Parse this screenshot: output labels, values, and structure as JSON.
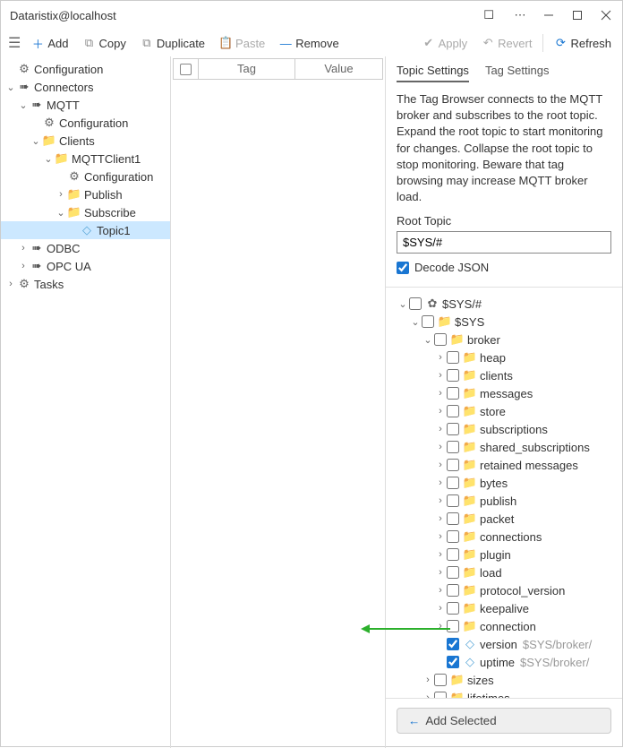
{
  "window": {
    "title": "Dataristix@localhost"
  },
  "toolbar": {
    "add": "Add",
    "copy": "Copy",
    "duplicate": "Duplicate",
    "paste": "Paste",
    "remove": "Remove",
    "apply": "Apply",
    "revert": "Revert",
    "refresh": "Refresh"
  },
  "left_tree": {
    "n0": "Configuration",
    "n1": "Connectors",
    "n2": "MQTT",
    "n3": "Configuration",
    "n4": "Clients",
    "n5": "MQTTClient1",
    "n6": "Configuration",
    "n7": "Publish",
    "n8": "Subscribe",
    "n9": "Topic1",
    "n10": "ODBC",
    "n11": "OPC UA",
    "n12": "Tasks"
  },
  "mid_cols": {
    "tag": "Tag",
    "value": "Value"
  },
  "tabs": {
    "topic": "Topic Settings",
    "tag": "Tag Settings"
  },
  "desc": "The Tag Browser connects to the MQTT broker and subscribes to the root topic. Expand the root topic to start monitoring for changes. Collapse the root topic to stop monitoring. Beware that tag browsing may increase MQTT broker load.",
  "root_topic_label": "Root Topic",
  "root_topic_value": "$SYS/#",
  "decode_json": "Decode JSON",
  "browser": {
    "root": "$SYS/#",
    "sys": "$SYS",
    "broker": "broker",
    "heap": "heap",
    "clients": "clients",
    "messages": "messages",
    "store": "store",
    "subscriptions": "subscriptions",
    "shared_subscriptions": "shared_subscriptions",
    "retained_messages": "retained messages",
    "bytes": "bytes",
    "publish": "publish",
    "packet": "packet",
    "connections": "connections",
    "plugin": "plugin",
    "load": "load",
    "protocol_version": "protocol_version",
    "keepalive": "keepalive",
    "connection": "connection",
    "version": "version",
    "version_path": "$SYS/broker/",
    "uptime": "uptime",
    "uptime_path": "$SYS/broker/",
    "sizes": "sizes",
    "lifetimes": "lifetimes"
  },
  "add_selected": "Add Selected"
}
